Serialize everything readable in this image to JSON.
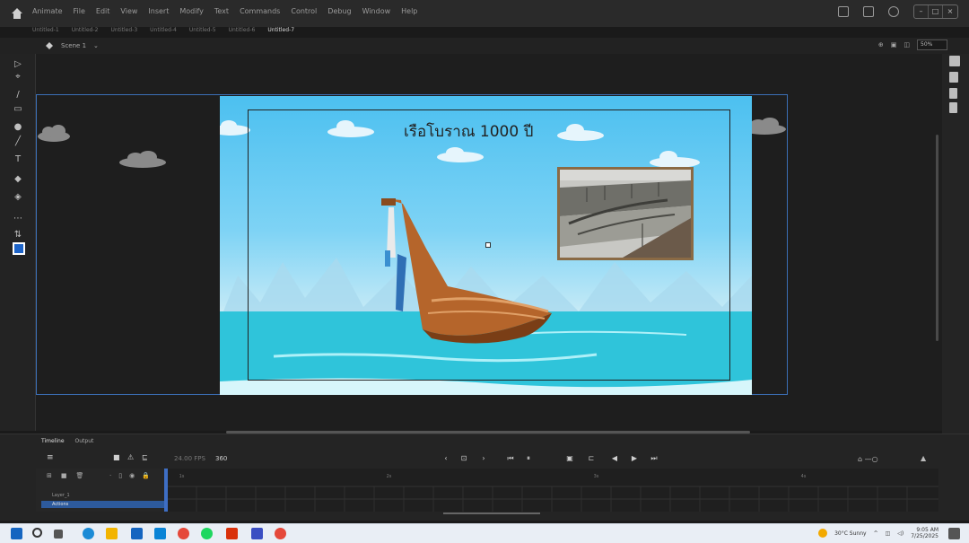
{
  "app": {
    "name": "Animate",
    "menu": [
      "File",
      "Edit",
      "View",
      "Insert",
      "Modify",
      "Text",
      "Commands",
      "Control",
      "Debug",
      "Window",
      "Help"
    ]
  },
  "doc_tabs": [
    "Untitled-1",
    "Untitled-2",
    "Untitled-3",
    "Untitled-4",
    "Untitled-5",
    "Untitled-6",
    "Untitled-7"
  ],
  "scene": {
    "name": "Scene 1",
    "zoom": "50%"
  },
  "stage": {
    "title_text": "เรือโบราณ 1000 ปี",
    "colors": {
      "sky_top": "#4cc0f0",
      "sea": "#2ec2d8",
      "boat": "#b5652b",
      "frame_border": "#3b6fb6"
    }
  },
  "timeline": {
    "tabs": [
      "Timeline",
      "Output"
    ],
    "fps": "24.00",
    "fps_unit": "FPS",
    "current_frame": "360",
    "frame_markers": [
      "1s",
      "",
      "",
      "",
      "",
      "",
      "",
      "2s",
      "",
      "",
      "",
      "",
      "",
      "",
      "3s",
      "",
      "",
      "",
      "",
      "",
      "",
      "4s",
      "",
      "",
      "",
      "",
      ""
    ],
    "layers": [
      {
        "name": "Layer_1",
        "active": false
      },
      {
        "name": "Actions",
        "active": true
      }
    ]
  },
  "taskbar": {
    "weather": "30°C Sunny",
    "time": "9:05 AM",
    "date": "7/25/2025"
  }
}
